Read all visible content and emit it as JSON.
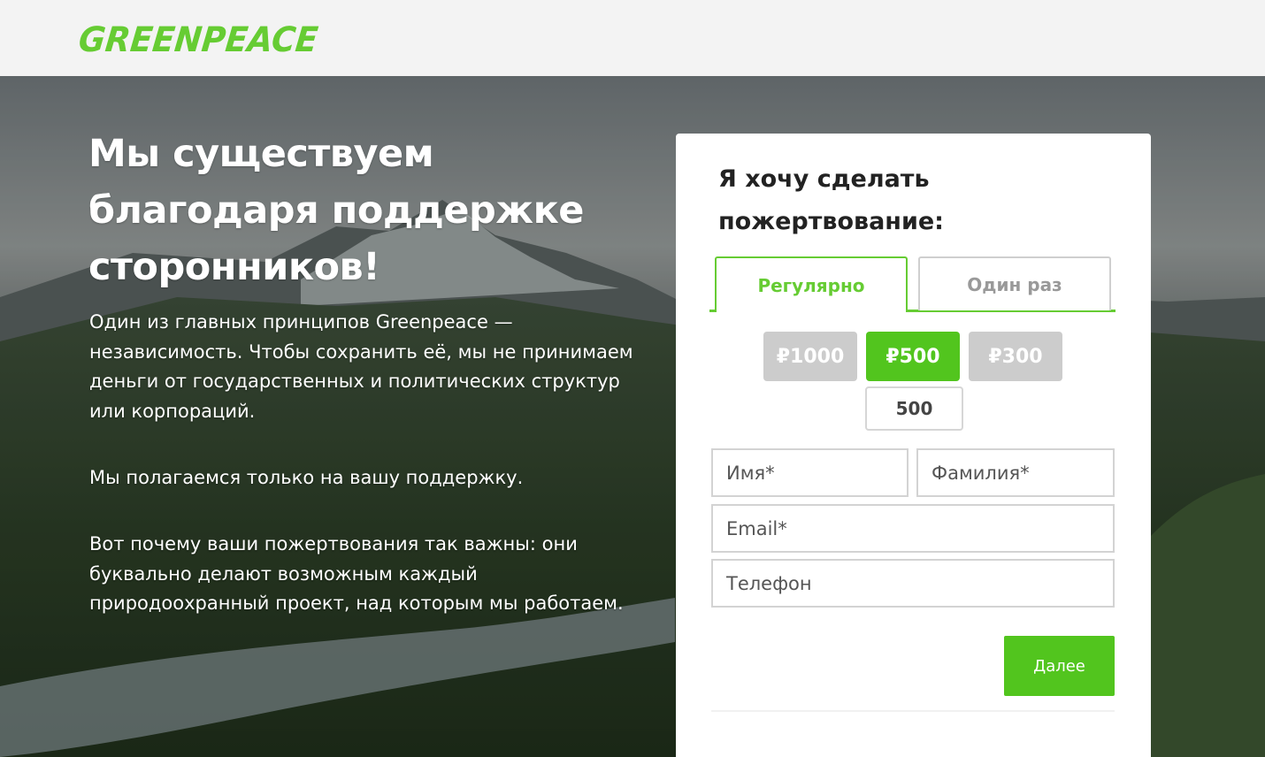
{
  "brand": {
    "logo_text": "GREENPEACE",
    "color": "#66cc33"
  },
  "hero": {
    "title": "Мы существуем благодаря поддержке сторонников!",
    "paragraphs": [
      "Один из главных принципов Greenpeace — независимость. Чтобы сохранить её, мы не принимаем деньги от государственных и политических структур или корпораций.",
      "Мы полагаемся только на вашу поддержку.",
      "Вот почему ваши пожертвования так важны: они буквально делают возможным каждый природоохранный проект, над которым мы работаем."
    ]
  },
  "donation_form": {
    "title": "Я хочу сделать пожертвование:",
    "tabs": [
      {
        "label": "Регулярно",
        "active": true
      },
      {
        "label": "Один раз",
        "active": false
      }
    ],
    "amounts": [
      {
        "label": "₽1000",
        "selected": false
      },
      {
        "label": "₽500",
        "selected": true
      },
      {
        "label": "₽300",
        "selected": false
      }
    ],
    "custom_amount_value": "500",
    "fields": {
      "first_name_placeholder": "Имя*",
      "last_name_placeholder": "Фамилия*",
      "email_placeholder": "Email*",
      "phone_placeholder": "Телефон"
    },
    "next_label": "Далее"
  },
  "colors": {
    "accent": "#52c51e",
    "inactive_amount": "#cccccc",
    "tab_inactive_text": "#999999"
  }
}
